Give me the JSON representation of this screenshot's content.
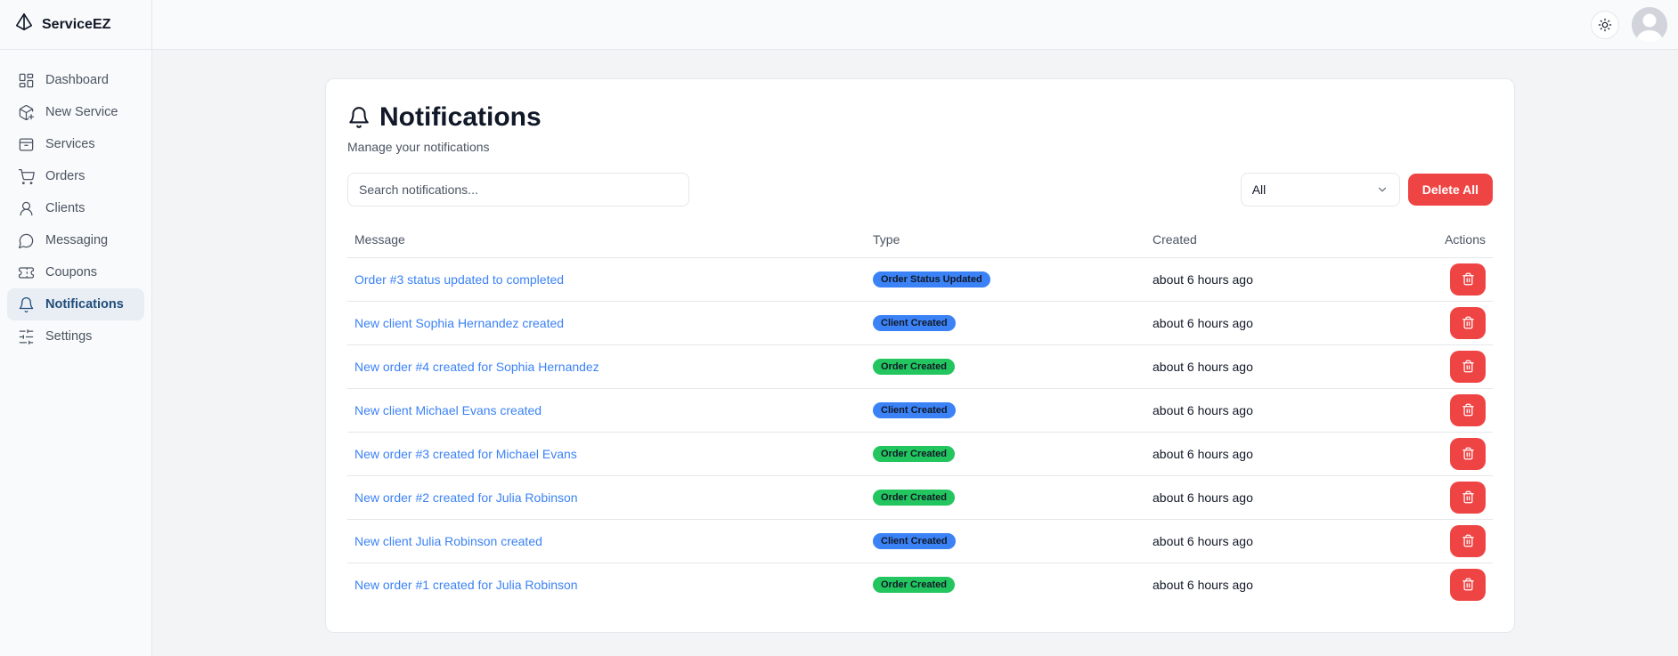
{
  "app": {
    "name": "ServiceEZ"
  },
  "sidebar": {
    "items": [
      {
        "label": "Dashboard",
        "icon": "dashboard-icon"
      },
      {
        "label": "New Service",
        "icon": "package-plus-icon"
      },
      {
        "label": "Services",
        "icon": "box-icon"
      },
      {
        "label": "Orders",
        "icon": "cart-icon"
      },
      {
        "label": "Clients",
        "icon": "user-icon"
      },
      {
        "label": "Messaging",
        "icon": "message-icon"
      },
      {
        "label": "Coupons",
        "icon": "ticket-icon"
      },
      {
        "label": "Notifications",
        "icon": "bell-icon",
        "active": true
      },
      {
        "label": "Settings",
        "icon": "sliders-icon"
      }
    ]
  },
  "header": {
    "theme_icon": "sun-icon",
    "avatar_icon": "user-avatar-icon"
  },
  "page": {
    "title": "Notifications",
    "subtitle": "Manage your notifications",
    "search_placeholder": "Search notifications...",
    "filter_value": "All",
    "delete_all_label": "Delete All"
  },
  "table": {
    "columns": {
      "message": "Message",
      "type": "Type",
      "created": "Created",
      "actions": "Actions"
    },
    "rows": [
      {
        "message": "Order #3 status updated to completed",
        "type": "Order Status Updated",
        "type_color": "#3b82f6",
        "created": "about 6 hours ago"
      },
      {
        "message": "New client Sophia Hernandez created",
        "type": "Client Created",
        "type_color": "#3b82f6",
        "created": "about 6 hours ago"
      },
      {
        "message": "New order #4 created for Sophia Hernandez",
        "type": "Order Created",
        "type_color": "#22c55e",
        "created": "about 6 hours ago"
      },
      {
        "message": "New client Michael Evans created",
        "type": "Client Created",
        "type_color": "#3b82f6",
        "created": "about 6 hours ago"
      },
      {
        "message": "New order #3 created for Michael Evans",
        "type": "Order Created",
        "type_color": "#22c55e",
        "created": "about 6 hours ago"
      },
      {
        "message": "New order #2 created for Julia Robinson",
        "type": "Order Created",
        "type_color": "#22c55e",
        "created": "about 6 hours ago"
      },
      {
        "message": "New client Julia Robinson created",
        "type": "Client Created",
        "type_color": "#3b82f6",
        "created": "about 6 hours ago"
      },
      {
        "message": "New order #1 created for Julia Robinson",
        "type": "Order Created",
        "type_color": "#22c55e",
        "created": "about 6 hours ago"
      }
    ]
  },
  "colors": {
    "accent": "#3b82f6",
    "danger": "#ef4444",
    "success": "#22c55e",
    "active_nav_bg": "#e9eef5"
  }
}
